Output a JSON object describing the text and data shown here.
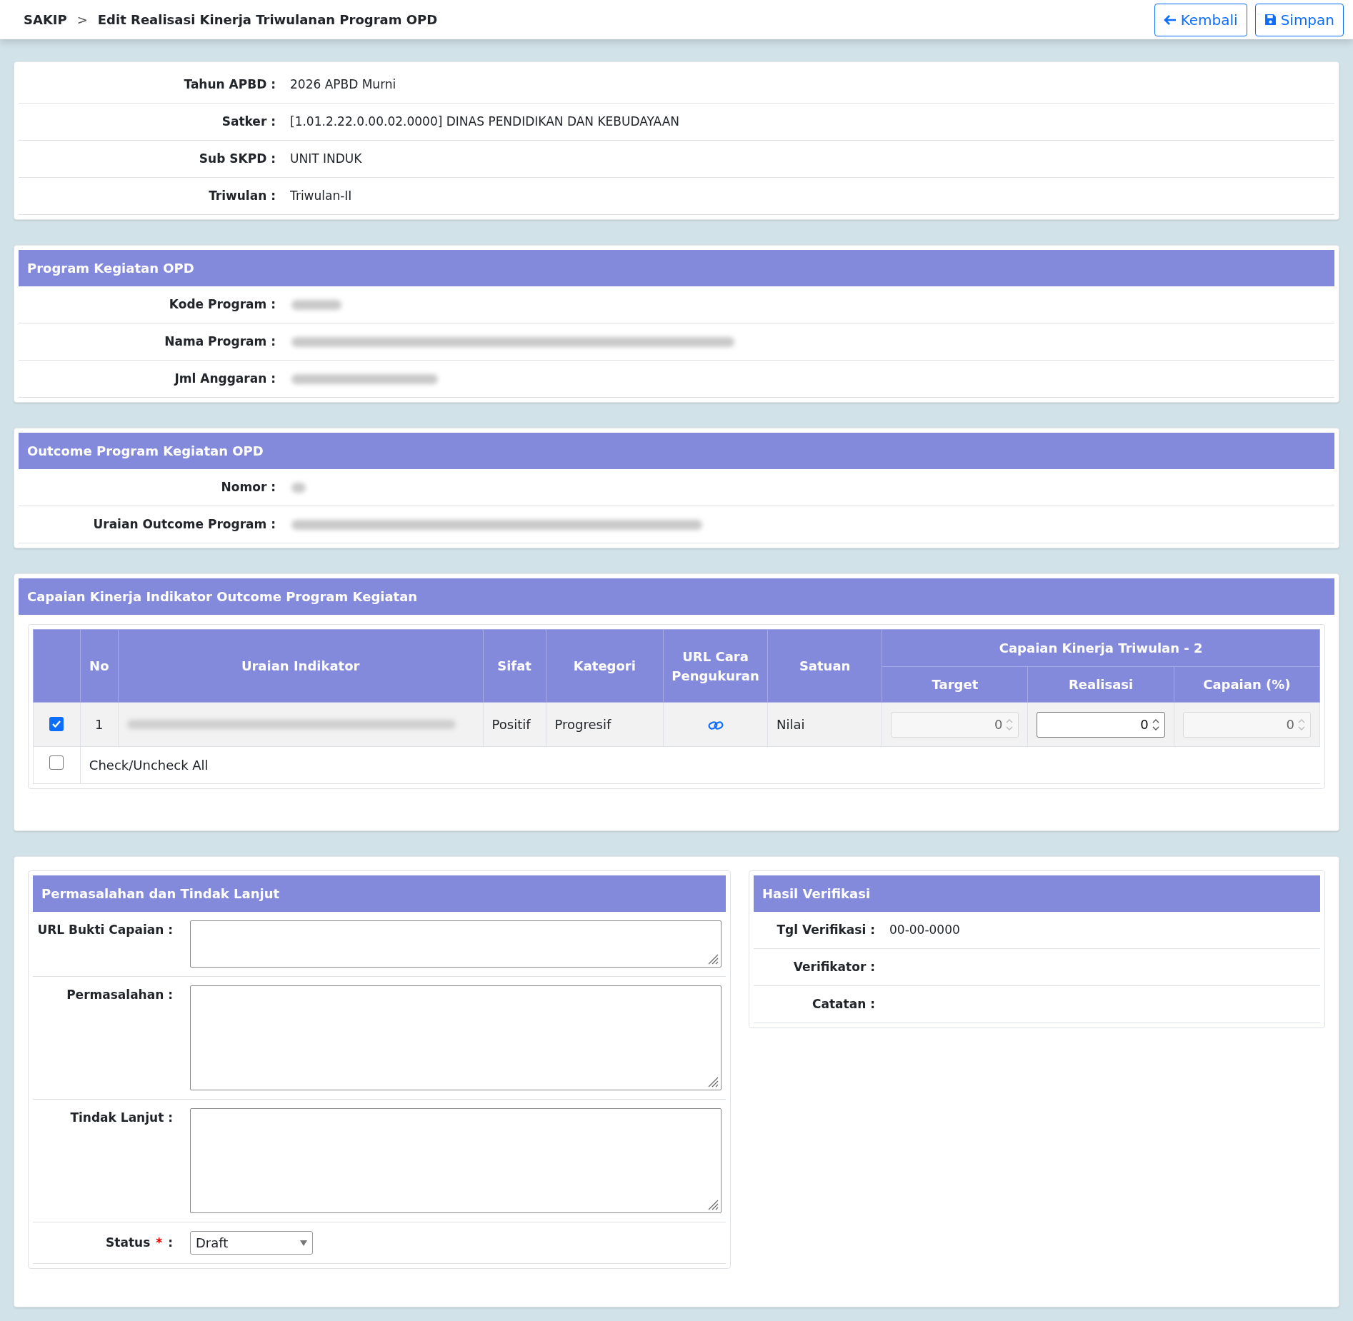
{
  "header": {
    "breadcrumb": [
      {
        "text": "SAKIP",
        "kind": "root"
      },
      {
        "text": ">",
        "kind": "sep"
      },
      {
        "text": "Edit Realisasi Kinerja Triwulanan Program OPD",
        "kind": "page"
      }
    ],
    "buttons": [
      {
        "label": "Kembali",
        "kind": "back"
      },
      {
        "label": "Simpan",
        "kind": "save"
      }
    ]
  },
  "info": {
    "rows": [
      {
        "label": "Tahun APBD :",
        "value": "2026 APBD Murni"
      },
      {
        "label": "Satker :",
        "value": "[1.01.2.22.0.00.02.0000] DINAS PENDIDIKAN DAN KEBUDAYAAN"
      },
      {
        "label": "Sub SKPD :",
        "value": "UNIT INDUK"
      },
      {
        "label": "Triwulan :",
        "value": "Triwulan-II"
      }
    ]
  },
  "program": {
    "title": "Program Kegiatan OPD",
    "rows": [
      {
        "label": "Kode Program :"
      },
      {
        "label": "Nama Program :"
      },
      {
        "label": "Jml Anggaran :"
      }
    ]
  },
  "outcome": {
    "title": "Outcome Program Kegiatan OPD",
    "rows": [
      {
        "label": "Nomor :"
      },
      {
        "label": "Uraian Outcome Program :"
      }
    ]
  },
  "capaian": {
    "title": "Capaian Kinerja Indikator Outcome Program Kegiatan",
    "columns": [
      "No",
      "Uraian Indikator",
      "Sifat",
      "Kategori",
      "URL Cara Pengukuran",
      "Satuan"
    ],
    "group": "Capaian Kinerja Triwulan - 2",
    "subcolumns": [
      "Target",
      "Realisasi",
      "Capaian (%)"
    ],
    "rows": [
      {
        "checked": true,
        "no": "1",
        "sifat": "Positif",
        "kategori": "Progresif",
        "satuan": "Nilai",
        "fields": [
          {
            "value": "0",
            "disabled": true
          },
          {
            "value": "0",
            "disabled": false
          },
          {
            "value": "0",
            "disabled": true
          }
        ]
      }
    ],
    "check_all": {
      "label": "Check/Uncheck All",
      "checked": false
    }
  },
  "permasalahan": {
    "title": "Permasalahan dan Tindak Lanjut",
    "fields": [
      {
        "label": "URL Bukti Capaian :",
        "kind": "short"
      },
      {
        "label": "Permasalahan :",
        "kind": "tall"
      },
      {
        "label": "Tindak Lanjut :",
        "kind": "tall"
      }
    ],
    "status": {
      "label": "Status",
      "required_mark": "*",
      "colon": ":",
      "value": "Draft"
    }
  },
  "verifikasi": {
    "title": "Hasil Verifikasi",
    "rows": [
      {
        "label": "Tgl Verifikasi :",
        "value": "00-00-0000"
      },
      {
        "label": "Verifikator :"
      },
      {
        "label": "Catatan :"
      }
    ]
  }
}
